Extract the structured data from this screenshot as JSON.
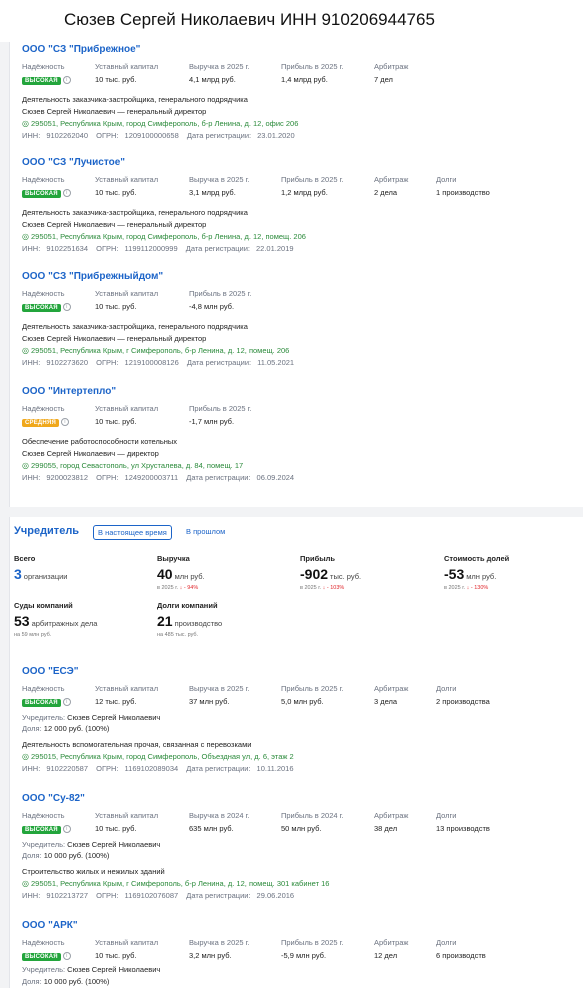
{
  "header": {
    "title": "Сюзев Сергей Николаевич ИНН 910206944765"
  },
  "labels": {
    "reliability": "Надёжность",
    "capital": "Уставный капитал",
    "arbitration": "Арбитраж",
    "debts": "Долги",
    "inn": "ИНН:",
    "ogrn": "ОГРН:",
    "reg_date": "Дата регистрации:",
    "founder": "Учредитель:",
    "share": "Доля:"
  },
  "companies_top": [
    {
      "name": "ООО \"СЗ \"Прибрежное\"",
      "badge": "ВЫСОКАЯ",
      "capital": "10 тыс. руб.",
      "revenue_label": "Выручка в 2025 г.",
      "revenue": "4,1 млрд руб.",
      "profit_label": "Прибыль в 2025 г.",
      "profit": "1,4 млрд руб.",
      "arbitration": "7 дел",
      "activity": "Деятельность заказчика-застройщика, генерального подрядчика",
      "person": "Сюзев Сергей Николаевич — генеральный директор",
      "address": "295051, Республика Крым, город Симферополь, б-р Ленина, д. 12, офис 206",
      "inn": "9102262040",
      "ogrn": "1209100000658",
      "reg": "23.01.2020"
    },
    {
      "name": "ООО \"СЗ \"Лучистое\"",
      "badge": "ВЫСОКАЯ",
      "capital": "10 тыс. руб.",
      "revenue_label": "Выручка в 2025 г.",
      "revenue": "3,1 млрд руб.",
      "profit_label": "Прибыль в 2025 г.",
      "profit": "1,2 млрд руб.",
      "arbitration": "2 дела",
      "debts": "1 производство",
      "activity": "Деятельность заказчика-застройщика, генерального подрядчика",
      "person": "Сюзев Сергей Николаевич — генеральный директор",
      "address": "295051, Республика Крым, город Симферополь, б-р Ленина, д. 12, помещ. 206",
      "inn": "9102251634",
      "ogrn": "1199112000999",
      "reg": "22.01.2019"
    },
    {
      "name": "ООО \"СЗ \"Прибрежныйдом\"",
      "badge": "ВЫСОКАЯ",
      "capital": "10 тыс. руб.",
      "profit_label": "Прибыль в 2025 г.",
      "profit": "-4,8 млн руб.",
      "activity": "Деятельность заказчика-застройщика, генерального подрядчика",
      "person": "Сюзев Сергей Николаевич — генеральный директор",
      "address": "295051, Республика Крым, г Симферополь, б-р Ленина, д. 12, помещ. 206",
      "inn": "9102273620",
      "ogrn": "1219100008126",
      "reg": "11.05.2021"
    },
    {
      "name": "ООО \"Интертепло\"",
      "badge": "СРЕДНЯЯ",
      "capital": "10 тыс. руб.",
      "profit_label": "Прибыль в 2025 г.",
      "profit": "-1,7 млн руб.",
      "activity": "Обеспечение работоспособности котельных",
      "person": "Сюзев Сергей Николаевич — директор",
      "address": "299055, город Севастополь, ул Хрусталева, д. 84, помещ. 17",
      "inn": "9200023812",
      "ogrn": "1249200003711",
      "reg": "06.09.2024"
    }
  ],
  "founder_section": {
    "title": "Учредитель",
    "tab_current": "В настоящее время",
    "tab_past": "В прошлом",
    "stats": {
      "total": {
        "label": "Всего",
        "value": "3",
        "unit": "организации"
      },
      "revenue": {
        "label": "Выручка",
        "value": "40",
        "unit": "млн руб.",
        "sub_prefix": "в 2025 г.",
        "sub_change": "↓ - 94%"
      },
      "profit": {
        "label": "Прибыль",
        "value": "-902",
        "unit": "тыс. руб.",
        "sub_prefix": "в 2025 г.",
        "sub_change": "↓ - 103%"
      },
      "shares": {
        "label": "Стоимость долей",
        "value": "-53",
        "unit": "млн руб.",
        "sub_prefix": "в 2025 г.",
        "sub_change": "↓ - 130%"
      },
      "courts": {
        "label": "Суды компаний",
        "value": "53",
        "unit": "арбитражных дела",
        "sub": "на 59 млн руб."
      },
      "debts": {
        "label": "Долги компаний",
        "value": "21",
        "unit": "производство",
        "sub": "на 485 тыс. руб."
      }
    }
  },
  "companies_founder": [
    {
      "name": "ООО \"ЕСЭ\"",
      "badge": "ВЫСОКАЯ",
      "capital": "12 тыс. руб.",
      "revenue_label": "Выручка в 2025 г.",
      "revenue": "37 млн руб.",
      "profit_label": "Прибыль в 2025 г.",
      "profit": "5,0 млн руб.",
      "arbitration": "3 дела",
      "debts": "2 производства",
      "founder": "Сюзев Сергей Николаевич",
      "share": "12 000 руб. (100%)",
      "activity": "Деятельность вспомогательная прочая, связанная с перевозками",
      "address": "295015, Республика Крым, город Симферополь, Объездная ул, д. 6, этаж 2",
      "inn": "9102220587",
      "ogrn": "1169102089034",
      "reg": "10.11.2016"
    },
    {
      "name": "ООО \"Су-82\"",
      "badge": "ВЫСОКАЯ",
      "capital": "10 тыс. руб.",
      "revenue_label": "Выручка в 2024 г.",
      "revenue": "635 млн руб.",
      "profit_label": "Прибыль в 2024 г.",
      "profit": "50 млн руб.",
      "arbitration": "38 дел",
      "debts": "13 производств",
      "founder": "Сюзев Сергей Николаевич",
      "share": "10 000 руб. (100%)",
      "activity": "Строительство жилых и нежилых зданий",
      "address": "295051, Республика Крым, г Симферополь, б-р Ленина, д. 12, помещ. 301 кабинет 16",
      "inn": "9102213727",
      "ogrn": "1169102076087",
      "reg": "29.06.2016"
    },
    {
      "name": "ООО \"АРК\"",
      "badge": "ВЫСОКАЯ",
      "capital": "10 тыс. руб.",
      "revenue_label": "Выручка в 2025 г.",
      "revenue": "3,2 млн руб.",
      "profit_label": "Прибыль в 2025 г.",
      "profit": "-5,9 млн руб.",
      "arbitration": "12 дел",
      "debts": "6 производств",
      "founder": "Сюзев Сергей Николаевич",
      "share": "10 000 руб. (100%)"
    }
  ]
}
